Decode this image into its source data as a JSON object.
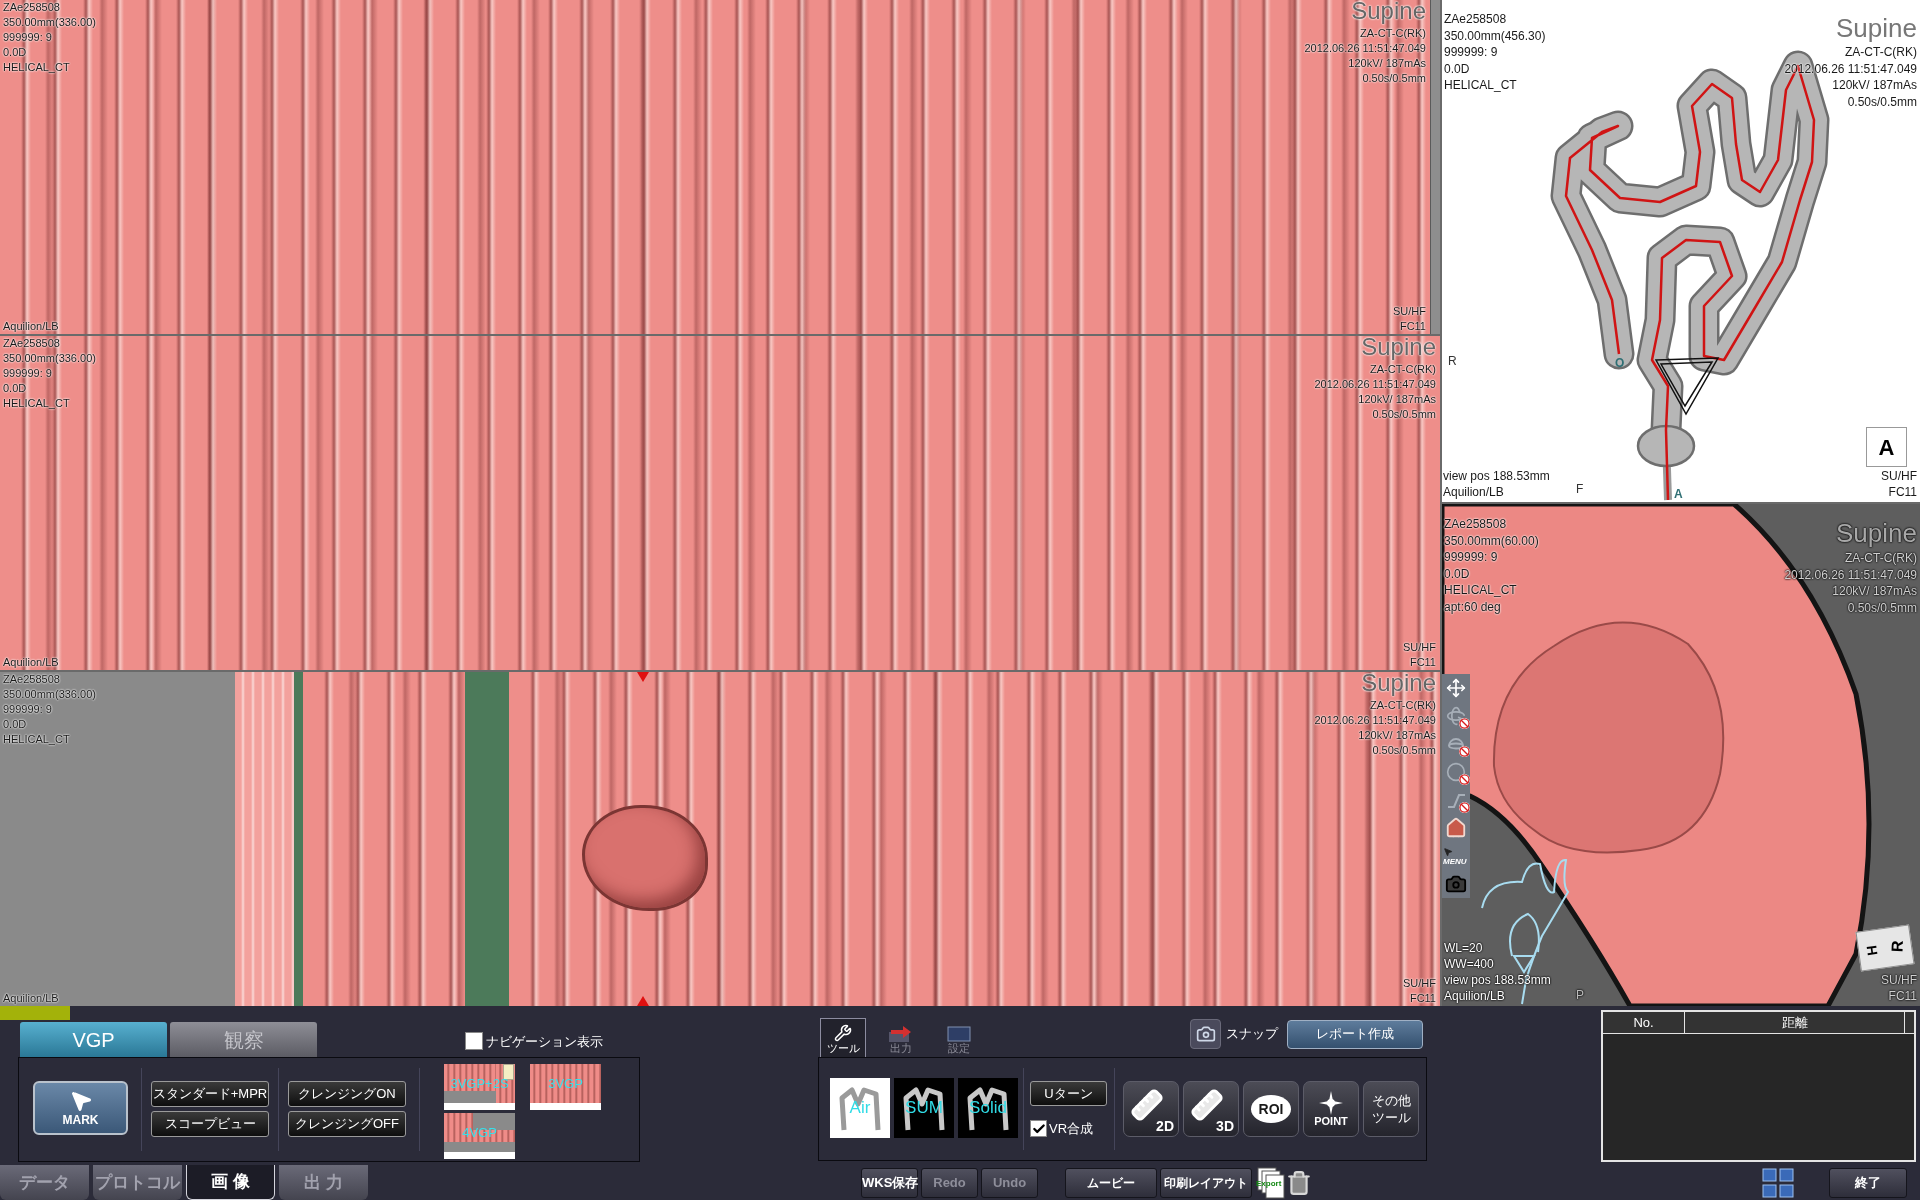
{
  "flat_views": [
    {
      "kind": "full",
      "scrollbar": true,
      "marker": false,
      "left_lines": [
        "ZAe258508",
        "350.00mm(336.00)",
        "999999: 9",
        "0.0D",
        "HELICAL_CT"
      ],
      "orientation": "Supine",
      "right_lines": [
        "ZA-CT-C(RK)",
        "2012.06.26 11:51:47.049",
        "120kV/ 187mAs",
        "0.50s/0.5mm"
      ],
      "bottom_left": "Aquilion/LB",
      "bottom_right": [
        "SU/HF",
        "FC11"
      ]
    },
    {
      "kind": "full",
      "scrollbar": false,
      "marker": false,
      "left_lines": [
        "ZAe258508",
        "350.00mm(336.00)",
        "999999: 9",
        "0.0D",
        "HELICAL_CT"
      ],
      "orientation": "Supine",
      "right_lines": [
        "ZA-CT-C(RK)",
        "2012.06.26 11:51:47.049",
        "120kV/ 187mAs",
        "0.50s/0.5mm"
      ],
      "bottom_left": "Aquilion/LB",
      "bottom_right": [
        "SU/HF",
        "FC11"
      ]
    },
    {
      "kind": "partial",
      "scrollbar": false,
      "marker": true,
      "left_lines": [
        "ZAe258508",
        "350.00mm(336.00)",
        "999999: 9",
        "0.0D",
        "HELICAL_CT"
      ],
      "orientation": "Supine",
      "right_lines": [
        "ZA-CT-C(RK)",
        "2012.06.26 11:51:47.049",
        "120kV/ 187mAs",
        "0.50s/0.5mm"
      ],
      "bottom_left": "Aquilion/LB",
      "bottom_right": [
        "SU/HF",
        "FC11"
      ]
    }
  ],
  "volume_view": {
    "left_lines": [
      "ZAe258508",
      "350.00mm(456.30)",
      "999999: 9",
      "0.0D",
      "HELICAL_CT"
    ],
    "orientation": "Supine",
    "right_lines": [
      "ZA-CT-C(RK)",
      "2012.06.26 11:51:47.049",
      "120kV/ 187mAs",
      "0.50s/0.5mm"
    ],
    "side_label": "R",
    "path_labels": [
      "O",
      "A"
    ],
    "bottom_label": "F",
    "bottom_left": [
      "view pos 188.53mm",
      "Aquilion/LB"
    ],
    "orientation_box": "A",
    "bottom_right": [
      "SU/HF",
      "FC11"
    ]
  },
  "endoscopic_view": {
    "left_lines": [
      "ZAe258508",
      "350.00mm(60.00)",
      "999999: 9",
      "0.0D",
      "HELICAL_CT",
      "apt:60 deg"
    ],
    "orientation": "Supine",
    "right_lines": [
      "ZA-CT-C(RK)",
      "2012.06.26 11:51:47.049",
      "120kV/ 187mAs",
      "0.50s/0.5mm"
    ],
    "bottom_left": [
      "WL=20",
      "WW=400",
      "view pos 188.53mm",
      "Aquilion/LB"
    ],
    "bottom_label": "P",
    "cube_labels": [
      "H",
      "R"
    ],
    "bottom_right": [
      "SU/HF",
      "FC11"
    ],
    "side_tools": [
      {
        "kind": "move",
        "disabled": false
      },
      {
        "kind": "rotate",
        "disabled": true
      },
      {
        "kind": "lens",
        "disabled": true
      },
      {
        "kind": "loop",
        "disabled": true
      },
      {
        "kind": "path",
        "disabled": true
      },
      {
        "kind": "home",
        "disabled": false
      },
      {
        "kind": "menu",
        "label": "MENU",
        "disabled": false
      },
      {
        "kind": "camera",
        "disabled": false
      }
    ]
  },
  "bottom_panel": {
    "mode_tabs": [
      {
        "label": "VGP",
        "selected": true
      },
      {
        "label": "観察",
        "selected": false
      }
    ],
    "navigation_toggle": {
      "label": "ナビゲーション表示",
      "checked": false
    },
    "mark_button": "MARK",
    "view_buttons": [
      "スタンダード+MPR",
      "スコープビュー"
    ],
    "cleansing_buttons": [
      "クレンジングON",
      "クレンジングOFF"
    ],
    "layouts": [
      {
        "kind": "split",
        "label": "3VGP+2S"
      },
      {
        "kind": "plain",
        "label": "3VGP"
      },
      {
        "kind": "stacked",
        "label": "4VGP"
      }
    ],
    "tool_tabs": [
      {
        "kind": "tools",
        "label": "ツール",
        "selected": true
      },
      {
        "kind": "output",
        "label": "出力",
        "selected": false
      },
      {
        "kind": "settings",
        "label": "設定",
        "selected": false
      }
    ],
    "snap_label": "スナップ",
    "report_button": "レポート作成",
    "render_modes": [
      {
        "kind": "light",
        "label": "Air"
      },
      {
        "kind": "dark",
        "label": "SUM"
      },
      {
        "kind": "dark",
        "label": "Solid"
      }
    ],
    "u_turn_button": "Uターン",
    "vr_composite": {
      "label": "VR合成",
      "checked": true
    },
    "measure_tools": [
      {
        "kind": "ruler",
        "label": "2D"
      },
      {
        "kind": "ruler",
        "label": "3D"
      },
      {
        "kind": "oval",
        "label": "ROI"
      },
      {
        "kind": "point",
        "label": "POINT"
      },
      {
        "kind": "text",
        "label": "その他ツール"
      }
    ],
    "measurements": {
      "columns": [
        "No.",
        "距離"
      ]
    },
    "bottom_tabs": [
      {
        "label": "データ",
        "selected": false
      },
      {
        "label": "プロトコル",
        "selected": false
      },
      {
        "label": "画 像",
        "selected": true
      },
      {
        "label": "出 力",
        "selected": false
      }
    ],
    "edit_buttons": [
      {
        "label": "WKS保存",
        "disabled": false
      },
      {
        "label": "Redo",
        "disabled": true
      },
      {
        "label": "Undo",
        "disabled": true
      }
    ],
    "output_buttons": [
      "ムービー",
      "印刷レイアウト"
    ],
    "export_label": "Export",
    "exit_button": "終了"
  }
}
